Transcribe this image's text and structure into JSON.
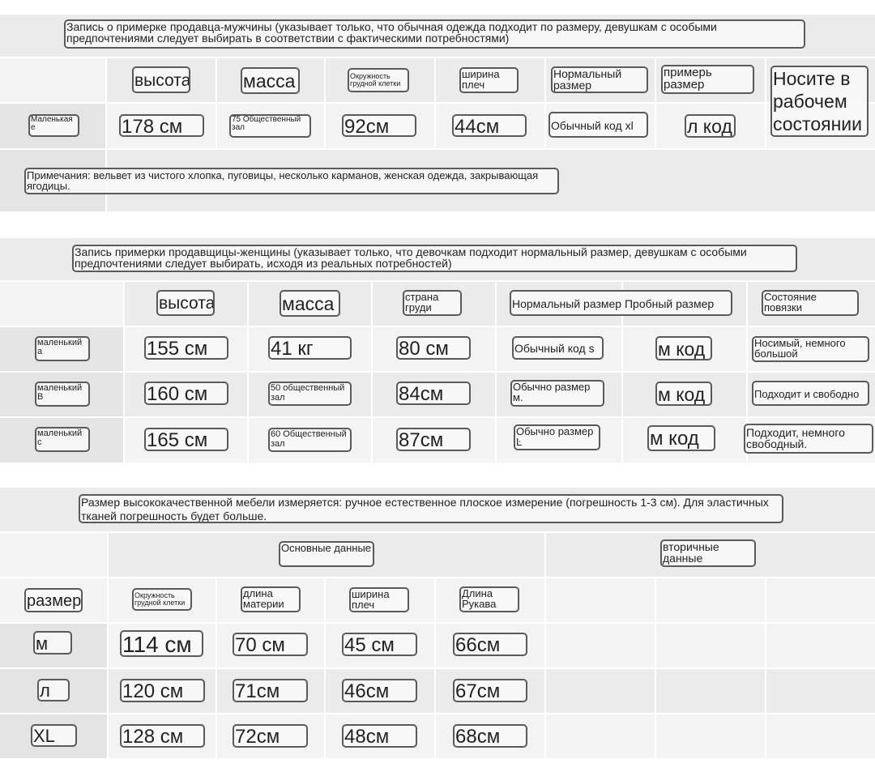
{
  "male": {
    "title": "Запись о примерке продавца-мужчины (указывает только, что обычная одежда подходит по размеру, девушкам с особыми предпочтениями следует выбирать в соответствии с фактическими потребностями)",
    "headers": {
      "height": "высота",
      "weight": "масса",
      "chest": "Окружность грудной клетки",
      "shoulder": "ширина плеч",
      "normal_size": "Нормальный размер",
      "try_size": "примерь размер",
      "wear": "Носите в рабочем состоянии"
    },
    "row": {
      "name": "Маленькая е",
      "height": "178 см",
      "weight": "75 Общественный зал",
      "chest": "92см",
      "shoulder": "44см",
      "normal_size": "Обычный код xl",
      "try_size": "л код"
    },
    "note": "Примечания: вельвет из чистого хлопка, пуговицы, несколько карманов, женская одежда, закрывающая ягодицы."
  },
  "female": {
    "title": "Запись примерки продавщицы-женщины (указывает только, что девочкам подходит нормальный размер, девушкам с особыми предпочтениями следует выбирать, исходя из реальных потребностей)",
    "headers": {
      "height": "высота",
      "weight": "масса",
      "chest": "страна груди",
      "sizes": "Нормальный размер Пробный размер",
      "state": "Состояние повязки"
    },
    "rows": [
      {
        "name": "маленький а",
        "height": "155 см",
        "weight": "41 кг",
        "chest": "80 см",
        "normal": "Обычный код s",
        "try": "м код",
        "state": "Носимый, немного большой"
      },
      {
        "name": "маленький В",
        "height": "160 см",
        "weight": "50 общественный зал",
        "chest": "84см",
        "normal": "Обычно размер м.",
        "try": "м код",
        "state": "Подходит и свободно"
      },
      {
        "name": "маленький с",
        "height": "165 см",
        "weight": "60 Общественный зал",
        "chest": "87см",
        "normal": "Обычно размер Ŀ",
        "try": "м код",
        "state": "Подходит, немного свободный."
      }
    ]
  },
  "size": {
    "title": "Размер высококачественной мебели измеряется: ручное естественное плоское измерение (погрешность 1-3 см). Для эластичных тканей погрешность будет больше.",
    "group_basic": "Основные данные",
    "group_secondary": "вторичные данные",
    "headers": {
      "size": "размер",
      "chest": "Окружность грудной клетки",
      "length": "длина материи",
      "shoulder": "ширина плеч",
      "sleeve": "Длина Рукава"
    },
    "rows": [
      {
        "size": "м",
        "chest": "114 см",
        "length": "70 см",
        "shoulder": "45 см",
        "sleeve": "66см"
      },
      {
        "size": "л",
        "chest": "120 см",
        "length": "71см",
        "shoulder": "46см",
        "sleeve": "67см"
      },
      {
        "size": "XL",
        "chest": "128 см",
        "length": "72см",
        "shoulder": "48см",
        "sleeve": "68см"
      }
    ]
  }
}
